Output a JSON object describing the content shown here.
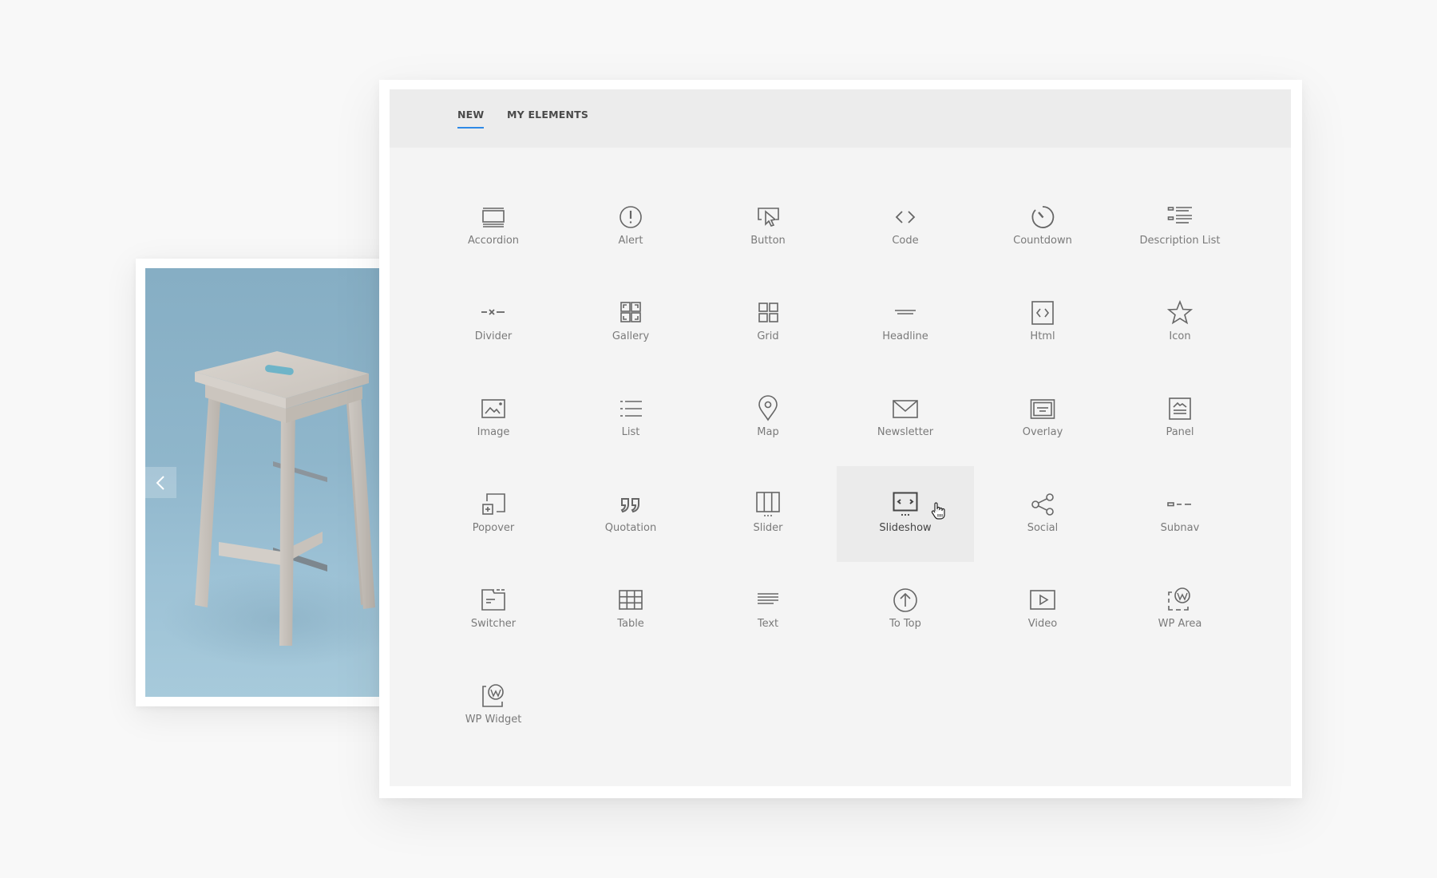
{
  "tabs": [
    {
      "label": "NEW",
      "active": true
    },
    {
      "label": "MY ELEMENTS",
      "active": false
    }
  ],
  "accent_color": "#2f8ae6",
  "elements": [
    {
      "label": "Accordion",
      "icon": "accordion-icon"
    },
    {
      "label": "Alert",
      "icon": "alert-icon"
    },
    {
      "label": "Button",
      "icon": "button-icon"
    },
    {
      "label": "Code",
      "icon": "code-icon"
    },
    {
      "label": "Countdown",
      "icon": "countdown-icon"
    },
    {
      "label": "Description List",
      "icon": "description-list-icon"
    },
    {
      "label": "Divider",
      "icon": "divider-icon"
    },
    {
      "label": "Gallery",
      "icon": "gallery-icon"
    },
    {
      "label": "Grid",
      "icon": "grid-icon"
    },
    {
      "label": "Headline",
      "icon": "headline-icon"
    },
    {
      "label": "Html",
      "icon": "html-icon"
    },
    {
      "label": "Icon",
      "icon": "star-icon"
    },
    {
      "label": "Image",
      "icon": "image-icon"
    },
    {
      "label": "List",
      "icon": "list-icon"
    },
    {
      "label": "Map",
      "icon": "map-pin-icon"
    },
    {
      "label": "Newsletter",
      "icon": "envelope-icon"
    },
    {
      "label": "Overlay",
      "icon": "overlay-icon"
    },
    {
      "label": "Panel",
      "icon": "panel-icon"
    },
    {
      "label": "Popover",
      "icon": "popover-icon"
    },
    {
      "label": "Quotation",
      "icon": "quotation-icon"
    },
    {
      "label": "Slider",
      "icon": "slider-icon"
    },
    {
      "label": "Slideshow",
      "icon": "slideshow-icon",
      "hovered": true
    },
    {
      "label": "Social",
      "icon": "share-icon"
    },
    {
      "label": "Subnav",
      "icon": "subnav-icon"
    },
    {
      "label": "Switcher",
      "icon": "switcher-icon"
    },
    {
      "label": "Table",
      "icon": "table-icon"
    },
    {
      "label": "Text",
      "icon": "text-icon"
    },
    {
      "label": "To Top",
      "icon": "arrow-up-circle-icon"
    },
    {
      "label": "Video",
      "icon": "video-icon"
    },
    {
      "label": "WP Area",
      "icon": "wordpress-area-icon"
    },
    {
      "label": "WP Widget",
      "icon": "wordpress-widget-icon"
    }
  ],
  "preview": {
    "subject": "wooden bar stool on blue background",
    "prev_icon": "chevron-left-icon",
    "next_icon": "chevron-right-icon"
  }
}
